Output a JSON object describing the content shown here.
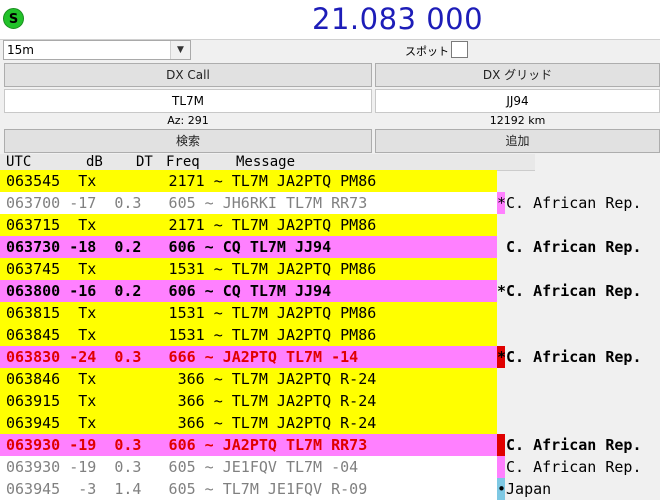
{
  "status_badge": "S",
  "frequency": "21.083 000",
  "band": "15m",
  "spot_label": "スポット",
  "dx_call_button": "DX Call",
  "dx_grid_button": "DX グリッド",
  "dx_call_value": "TL7M",
  "dx_grid_value": "JJ94",
  "azimuth": "Az: 291",
  "distance": "12192 km",
  "search_button": "検索",
  "add_button": "追加",
  "table_headers": {
    "utc": "UTC",
    "db": "dB",
    "dt": "DT",
    "freq": "Freq",
    "message": "Message"
  },
  "rows": [
    {
      "text": "063545  Tx        2171 ~ TL7M JA2PTQ PM86",
      "bg": "yellow",
      "style": "normal",
      "tag": "",
      "country": ""
    },
    {
      "text": "063700 -17  0.3   605 ~ JH6RKI TL7M RR73",
      "bg": "white",
      "style": "gray",
      "tag": "#ff80ff",
      "country": "*C. African Rep."
    },
    {
      "text": "063715  Tx        2171 ~ TL7M JA2PTQ PM86",
      "bg": "yellow",
      "style": "normal",
      "tag": "",
      "country": ""
    },
    {
      "text": "063730 -18  0.2   606 ~ CQ TL7M JJ94",
      "bg": "magenta",
      "style": "bold",
      "tag": "",
      "country": " C. African Rep."
    },
    {
      "text": "063745  Tx        1531 ~ TL7M JA2PTQ PM86",
      "bg": "yellow",
      "style": "normal",
      "tag": "",
      "country": ""
    },
    {
      "text": "063800 -16  0.2   606 ~ CQ TL7M JJ94",
      "bg": "magenta",
      "style": "bold",
      "tag": "",
      "country": "*C. African Rep."
    },
    {
      "text": "063815  Tx        1531 ~ TL7M JA2PTQ PM86",
      "bg": "yellow",
      "style": "normal",
      "tag": "",
      "country": ""
    },
    {
      "text": "063845  Tx        1531 ~ TL7M JA2PTQ PM86",
      "bg": "yellow",
      "style": "normal",
      "tag": "",
      "country": ""
    },
    {
      "text": "063830 -24  0.3   666 ~ JA2PTQ TL7M -14",
      "bg": "magenta",
      "style": "red",
      "tag": "#e00000",
      "country": "*C. African Rep."
    },
    {
      "text": "063846  Tx         366 ~ TL7M JA2PTQ R-24",
      "bg": "yellow",
      "style": "normal",
      "tag": "",
      "country": ""
    },
    {
      "text": "063915  Tx         366 ~ TL7M JA2PTQ R-24",
      "bg": "yellow",
      "style": "normal",
      "tag": "",
      "country": ""
    },
    {
      "text": "063945  Tx         366 ~ TL7M JA2PTQ R-24",
      "bg": "yellow",
      "style": "normal",
      "tag": "",
      "country": ""
    },
    {
      "text": "063930 -19  0.3   606 ~ JA2PTQ TL7M RR73",
      "bg": "magenta",
      "style": "red",
      "tag": "#e00000",
      "country": " C. African Rep."
    },
    {
      "text": "063930 -19  0.3   605 ~ JE1FQV TL7M -04",
      "bg": "white",
      "style": "gray",
      "tag": "#ff80ff",
      "country": " C. African Rep."
    },
    {
      "text": "063945  -3  1.4   605 ~ TL7M JE1FQV R-09",
      "bg": "white",
      "style": "gray",
      "tag": "#7ec8e3",
      "country": "•Japan"
    }
  ]
}
